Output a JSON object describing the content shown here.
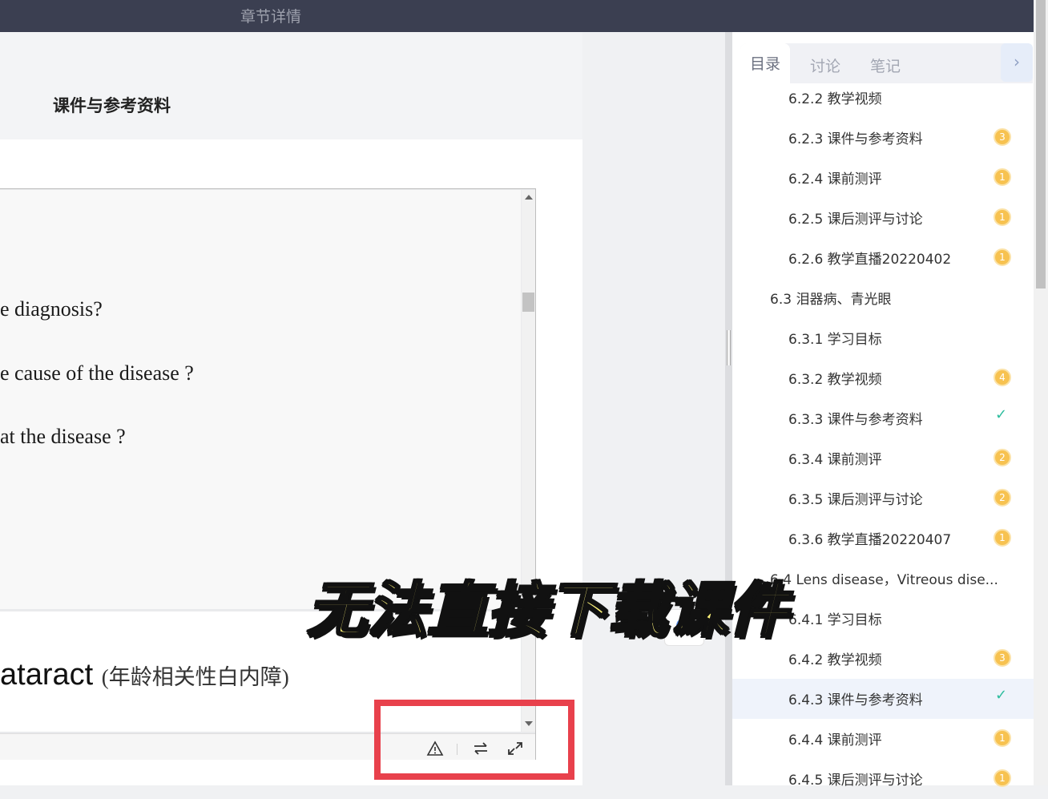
{
  "topbar": {
    "title": "章节详情"
  },
  "section": {
    "heading": "课件与参考资料"
  },
  "slide": {
    "questions": [
      "e diagnosis?",
      "e cause of the disease ?",
      "at the disease ?"
    ],
    "title_en": "ataract",
    "title_cn": "(年龄相关性白内障)"
  },
  "viewer_toolbar": {
    "report_icon": "warning-triangle-icon",
    "switch_icon": "swap-arrows-icon",
    "fullscreen_icon": "expand-icon"
  },
  "sidebar": {
    "tabs": [
      "目录",
      "讨论",
      "笔记"
    ],
    "active_tab": "目录",
    "items": [
      {
        "label": "6.2.2 教学视频",
        "level": "sub",
        "status": "",
        "badge": ""
      },
      {
        "label": "6.2.3 课件与参考资料",
        "level": "sub",
        "status": "badge",
        "badge": "3"
      },
      {
        "label": "6.2.4 课前测评",
        "level": "sub",
        "status": "badge",
        "badge": "1"
      },
      {
        "label": "6.2.5 课后测评与讨论",
        "level": "sub",
        "status": "badge",
        "badge": "1"
      },
      {
        "label": "6.2.6 教学直播20220402",
        "level": "sub",
        "status": "badge",
        "badge": "1"
      },
      {
        "label": "6.3 泪器病、青光眼",
        "level": "sec",
        "status": "",
        "badge": ""
      },
      {
        "label": "6.3.1 学习目标",
        "level": "sub",
        "status": "",
        "badge": ""
      },
      {
        "label": "6.3.2 教学视频",
        "level": "sub",
        "status": "badge",
        "badge": "4"
      },
      {
        "label": "6.3.3 课件与参考资料",
        "level": "sub",
        "status": "check",
        "badge": ""
      },
      {
        "label": "6.3.4 课前测评",
        "level": "sub",
        "status": "badge",
        "badge": "2"
      },
      {
        "label": "6.3.5 课后测评与讨论",
        "level": "sub",
        "status": "badge",
        "badge": "2"
      },
      {
        "label": "6.3.6 教学直播20220407",
        "level": "sub",
        "status": "badge",
        "badge": "1"
      },
      {
        "label": "6.4 Lens disease，Vitreous dise...",
        "level": "sec",
        "status": "",
        "badge": ""
      },
      {
        "label": "6.4.1 学习目标",
        "level": "sub",
        "status": "",
        "badge": ""
      },
      {
        "label": "6.4.2 教学视频",
        "level": "sub",
        "status": "badge",
        "badge": "3"
      },
      {
        "label": "6.4.3 课件与参考资料",
        "level": "sub",
        "status": "check",
        "badge": "",
        "selected": true
      },
      {
        "label": "6.4.4 课前测评",
        "level": "sub",
        "status": "badge",
        "badge": "1"
      },
      {
        "label": "6.4.5 课后测评与讨论",
        "level": "sub",
        "status": "badge",
        "badge": "1"
      }
    ]
  },
  "overlay": {
    "caption": "无法直接下载课件"
  },
  "colors": {
    "highlight": "#e8414c",
    "badge": "#f7c250",
    "check": "#2ebd9e",
    "caption": "#fbf17a"
  }
}
